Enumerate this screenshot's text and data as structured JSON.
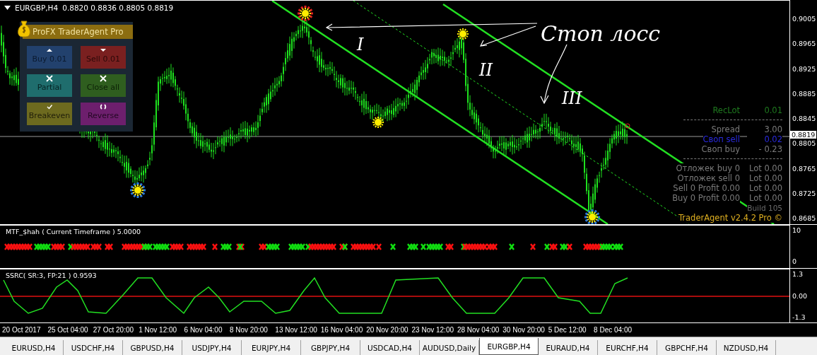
{
  "chart_header": {
    "symbol": "EURGBP,H4",
    "prices": "0.8820 0.8836 0.8805 0.8819"
  },
  "trade_panel": {
    "title": "ProFX TraderAgent Pro",
    "buttons": [
      {
        "kind": "buy",
        "label": "Buy 0.01"
      },
      {
        "kind": "sell",
        "label": "Sell 0.01"
      },
      {
        "kind": "partial",
        "label": "Partial"
      },
      {
        "kind": "closeall",
        "label": "Close all"
      },
      {
        "kind": "breakeven",
        "label": "Breakeven"
      },
      {
        "kind": "reverse",
        "label": "Reverse"
      }
    ]
  },
  "annotations": {
    "caption": "Стоп лосс",
    "marks": [
      "I",
      "II",
      "III"
    ]
  },
  "info_panel": {
    "sections": [
      [
        {
          "label": "RecLot",
          "value": "0.01",
          "color": "#1f7a1f"
        }
      ],
      [
        {
          "label": "Spread",
          "value": "3.00",
          "color": "#7a7a7a"
        },
        {
          "label": "Своп sell",
          "value": "0.02",
          "color": "#2a2ae0"
        },
        {
          "label": "Своп buy",
          "value": "- 0.23",
          "color": "#7a7a7a"
        }
      ],
      [
        {
          "label": "Отложек buy 0",
          "value": "Lot 0.00",
          "color": "#7a7a7a"
        },
        {
          "label": "Отложек sell 0",
          "value": "Lot 0.00",
          "color": "#7a7a7a"
        },
        {
          "label": "Sell 0  Profit 0.00",
          "value": "Lot 0.00",
          "color": "#7a7a7a"
        },
        {
          "label": "Buy 0  Profit 0.00",
          "value": "Lot 0.00",
          "color": "#7a7a7a"
        }
      ]
    ],
    "build": "Build 105",
    "version": "TraderAgent v2.4.2 Pro ©"
  },
  "price_axis": {
    "ticks": [
      "0.9005",
      "0.8965",
      "0.8925",
      "0.8885",
      "0.8845",
      "0.8805",
      "0.8765",
      "0.8725",
      "0.8685"
    ],
    "current": "0.8819"
  },
  "indicator_1": {
    "title": "MTF_$hah ( Current Timeframe )  5.0000",
    "scale": [
      "10",
      "0"
    ]
  },
  "indicator_2": {
    "title": "SSRC( SR:3, FP:21 ) 0.9593",
    "scale": [
      "1.3",
      "0.00",
      "-1.3"
    ]
  },
  "time_axis": [
    "20 Oct 2017",
    "25 Oct 04:00",
    "27 Oct 20:00",
    "1 Nov 12:00",
    "6 Nov 04:00",
    "8 Nov 20:00",
    "13 Nov 12:00",
    "16 Nov 04:00",
    "20 Nov 20:00",
    "23 Nov 12:00",
    "28 Nov 04:00",
    "30 Nov 20:00",
    "5 Dec 12:00",
    "8 Dec 04:00"
  ],
  "tabs": [
    {
      "label": "EURUSD,H4",
      "selected": false
    },
    {
      "label": "USDCHF,H4",
      "selected": false
    },
    {
      "label": "GBPUSD,H4",
      "selected": false
    },
    {
      "label": "USDJPY,H4",
      "selected": false
    },
    {
      "label": "EURJPY,H4",
      "selected": false
    },
    {
      "label": "GBPJPY,H4",
      "selected": false
    },
    {
      "label": "USDCAD,H4",
      "selected": false
    },
    {
      "label": "AUDUSD,Daily",
      "selected": false
    },
    {
      "label": "EURGBP,H4",
      "selected": true
    },
    {
      "label": "EURAUD,H4",
      "selected": false
    },
    {
      "label": "EURCHF,H4",
      "selected": false
    },
    {
      "label": "GBPCHF,H4",
      "selected": false
    },
    {
      "label": "NZDUSD,H4",
      "selected": false
    }
  ]
}
